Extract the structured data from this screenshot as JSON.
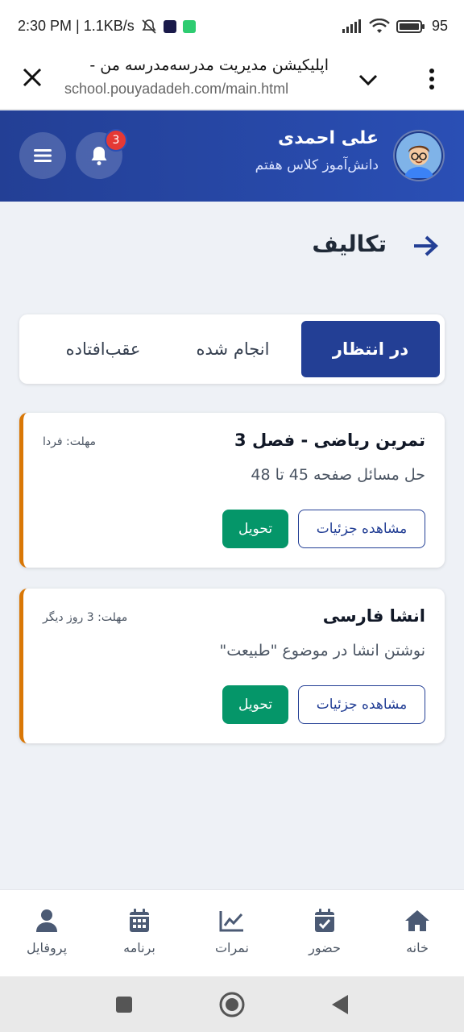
{
  "status_bar": {
    "time_speed": "2:30 PM | 1.1KB/s",
    "battery": "95"
  },
  "browser": {
    "title": "اپلیکیشن مدیریت مدرسه‌مدرسه من -",
    "url": "school.pouyadadeh.com/main.html"
  },
  "header": {
    "user_name": "علی احمدی",
    "user_role": "دانش‌آموز کلاس هفتم",
    "notification_count": "3"
  },
  "page": {
    "title": "تکالیف"
  },
  "tabs": [
    {
      "label": "در انتظار",
      "active": true
    },
    {
      "label": "انجام شده",
      "active": false
    },
    {
      "label": "عقب‌افتاده",
      "active": false
    }
  ],
  "assignments": [
    {
      "title": "تمرین ریاضی - فصل 3",
      "deadline": "مهلت: فردا",
      "description": "حل مسائل صفحه 45 تا 48",
      "details_label": "مشاهده جزئیات",
      "submit_label": "تحویل"
    },
    {
      "title": "انشا فارسی",
      "deadline": "مهلت: 3 روز دیگر",
      "description": "نوشتن انشا در موضوع \"طبیعت\"",
      "details_label": "مشاهده جزئیات",
      "submit_label": "تحویل"
    }
  ],
  "bottom_nav": [
    {
      "label": "خانه",
      "icon": "home-icon"
    },
    {
      "label": "حضور",
      "icon": "calendar-check-icon"
    },
    {
      "label": "نمرات",
      "icon": "chart-line-icon"
    },
    {
      "label": "برنامه",
      "icon": "calendar-icon"
    },
    {
      "label": "پروفایل",
      "icon": "user-icon"
    }
  ],
  "colors": {
    "primary": "#233f95",
    "accent_orange": "#d97706",
    "success": "#059669",
    "badge": "#e53935"
  }
}
